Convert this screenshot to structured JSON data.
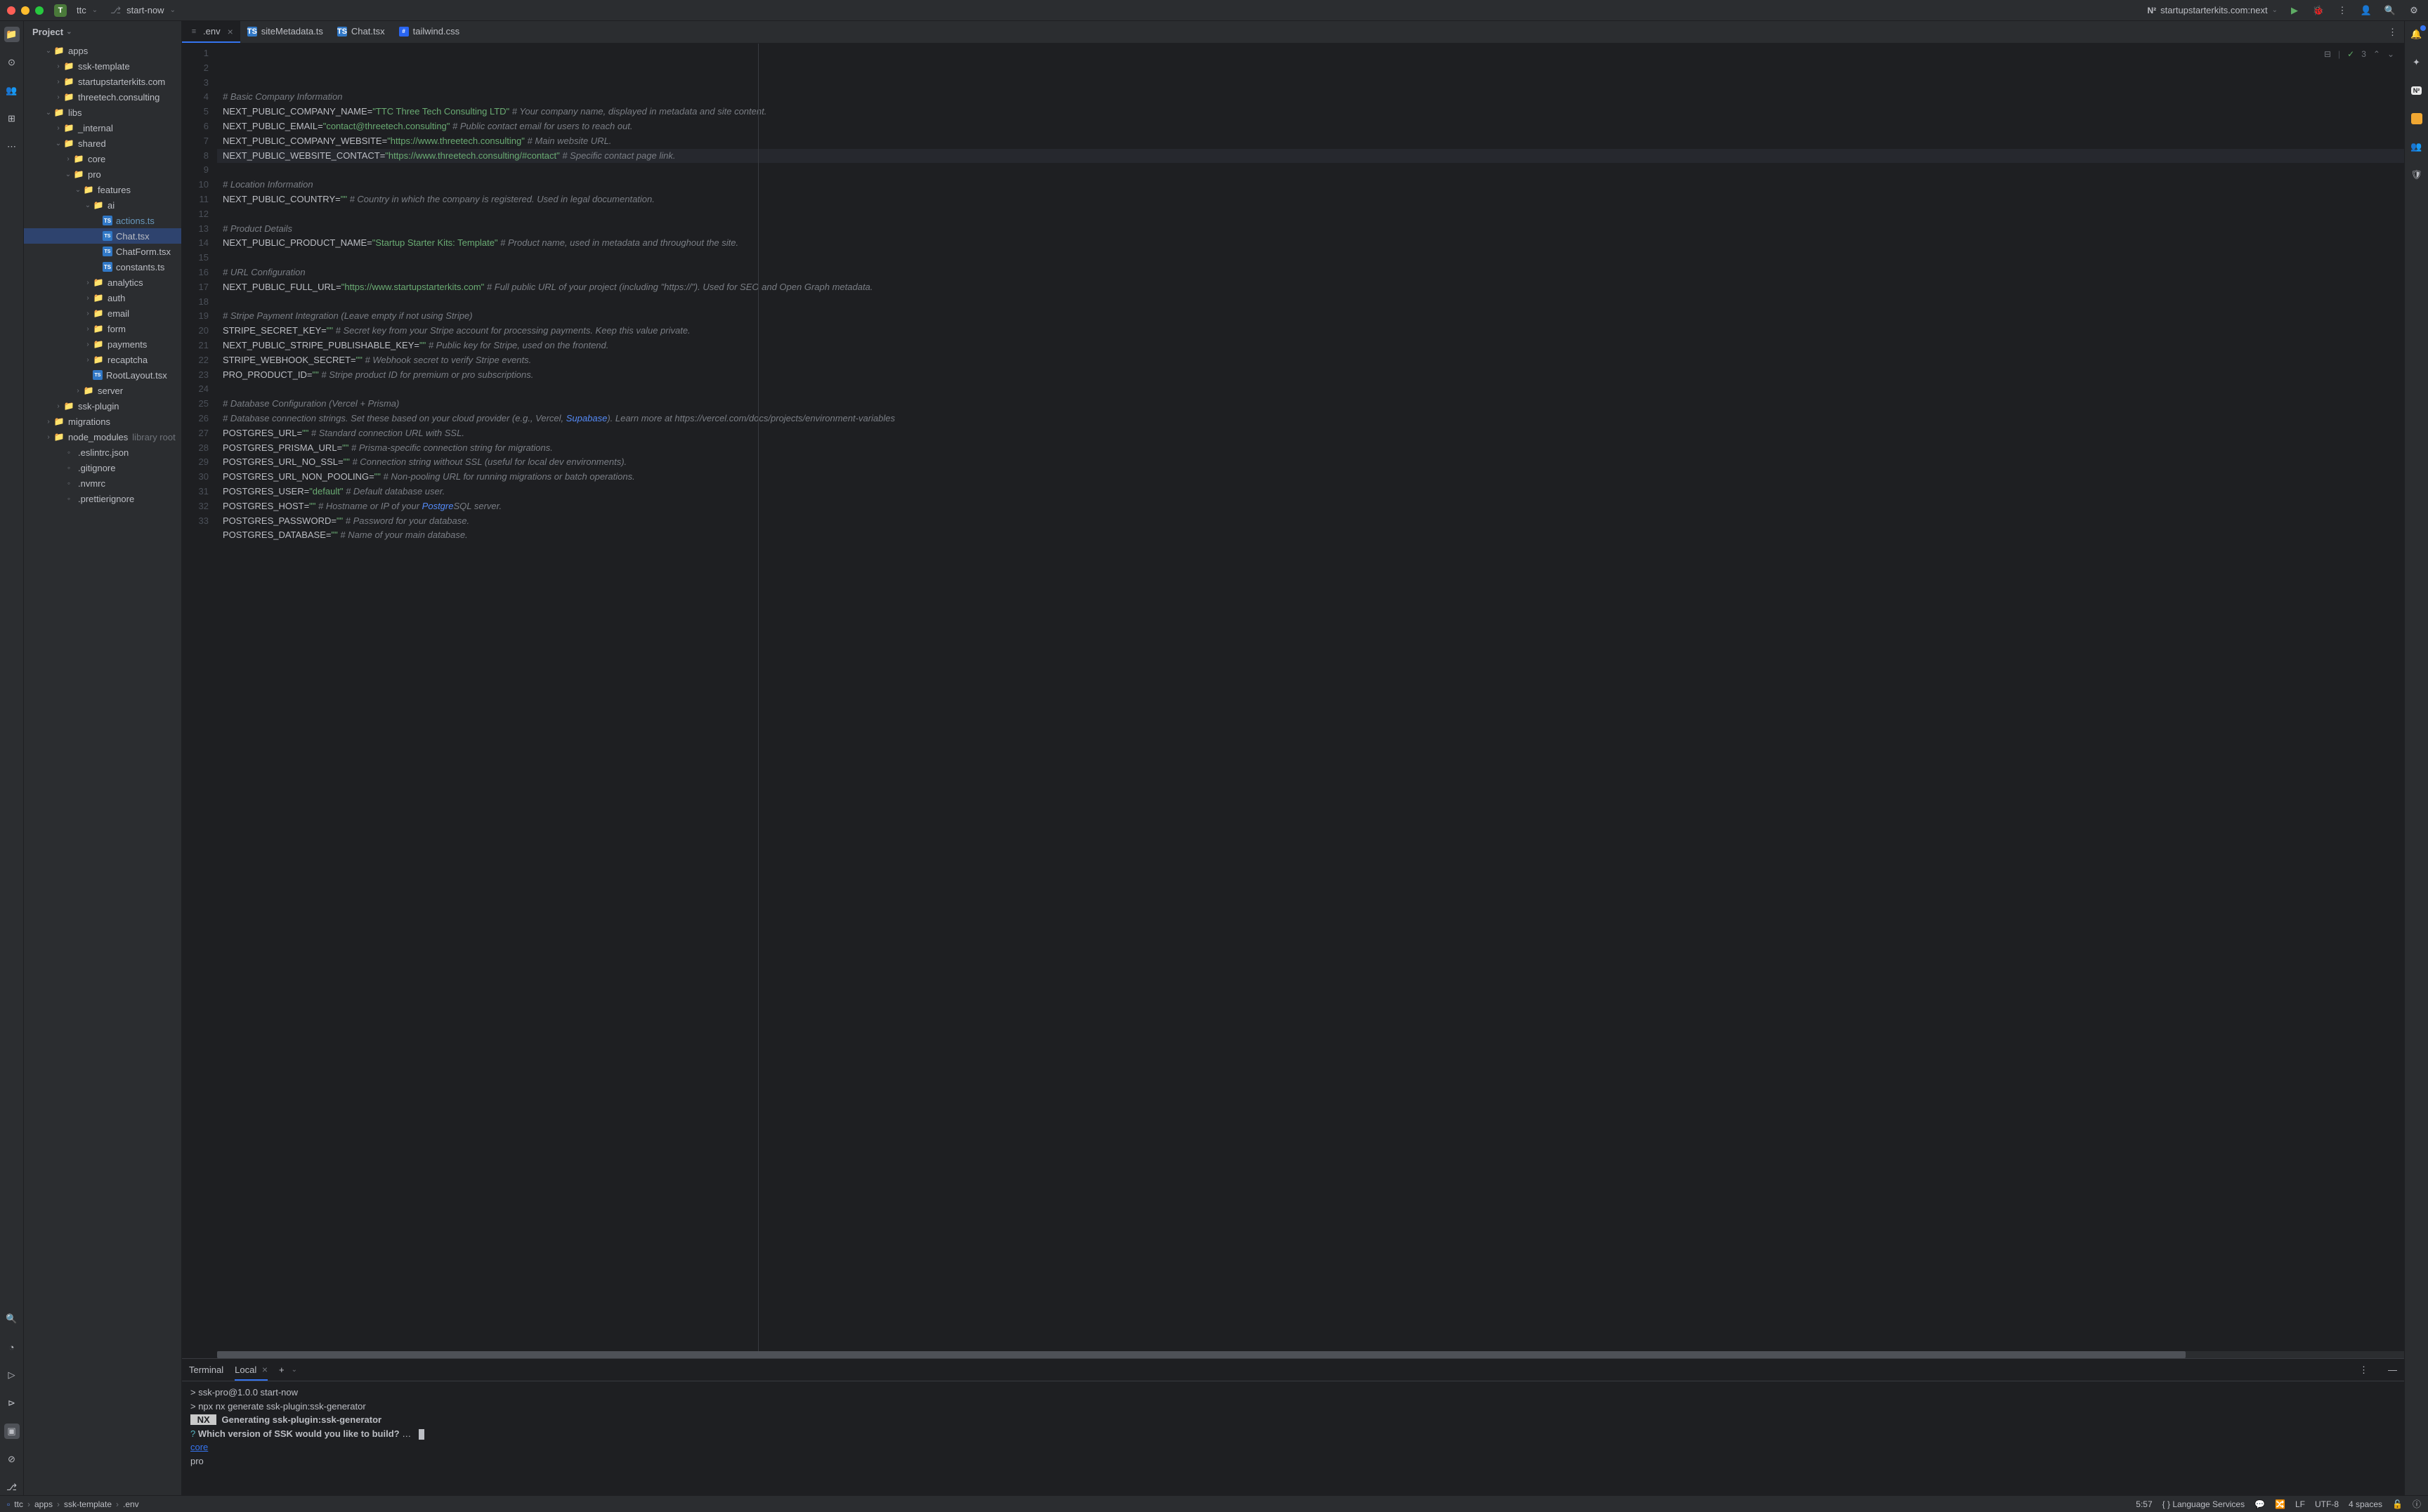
{
  "titlebar": {
    "project_initial": "T",
    "project_name": "ttc",
    "branch": "start-now",
    "run_config_prefix": "N²",
    "run_config": "startupstarterkits.com:next"
  },
  "sidebar": {
    "header": "Project"
  },
  "tree": [
    {
      "depth": 2,
      "chevron": "down",
      "icon": "folder",
      "label": "apps"
    },
    {
      "depth": 3,
      "chevron": "right",
      "icon": "folder",
      "label": "ssk-template"
    },
    {
      "depth": 3,
      "chevron": "right",
      "icon": "folder",
      "label": "startupstarterkits.com"
    },
    {
      "depth": 3,
      "chevron": "right",
      "icon": "folder",
      "label": "threetech.consulting"
    },
    {
      "depth": 2,
      "chevron": "down",
      "icon": "folder",
      "label": "libs"
    },
    {
      "depth": 3,
      "chevron": "right",
      "icon": "folder",
      "label": "_internal"
    },
    {
      "depth": 3,
      "chevron": "down",
      "icon": "folder",
      "label": "shared"
    },
    {
      "depth": 4,
      "chevron": "right",
      "icon": "folder",
      "label": "core"
    },
    {
      "depth": 4,
      "chevron": "down",
      "icon": "folder",
      "label": "pro"
    },
    {
      "depth": 5,
      "chevron": "down",
      "icon": "folder",
      "label": "features"
    },
    {
      "depth": 6,
      "chevron": "down",
      "icon": "folder",
      "label": "ai"
    },
    {
      "depth": 7,
      "chevron": "",
      "icon": "ts",
      "label": "actions.ts",
      "changed": true
    },
    {
      "depth": 7,
      "chevron": "",
      "icon": "tsx",
      "label": "Chat.tsx",
      "selected": true
    },
    {
      "depth": 7,
      "chevron": "",
      "icon": "tsx",
      "label": "ChatForm.tsx"
    },
    {
      "depth": 7,
      "chevron": "",
      "icon": "ts",
      "label": "constants.ts"
    },
    {
      "depth": 6,
      "chevron": "right",
      "icon": "folder",
      "label": "analytics"
    },
    {
      "depth": 6,
      "chevron": "right",
      "icon": "folder",
      "label": "auth"
    },
    {
      "depth": 6,
      "chevron": "right",
      "icon": "folder",
      "label": "email"
    },
    {
      "depth": 6,
      "chevron": "right",
      "icon": "folder",
      "label": "form"
    },
    {
      "depth": 6,
      "chevron": "right",
      "icon": "folder",
      "label": "payments"
    },
    {
      "depth": 6,
      "chevron": "right",
      "icon": "folder",
      "label": "recaptcha"
    },
    {
      "depth": 6,
      "chevron": "",
      "icon": "tsx",
      "label": "RootLayout.tsx"
    },
    {
      "depth": 5,
      "chevron": "right",
      "icon": "folder",
      "label": "server"
    },
    {
      "depth": 3,
      "chevron": "right",
      "icon": "folder",
      "label": "ssk-plugin"
    },
    {
      "depth": 2,
      "chevron": "right",
      "icon": "folder",
      "label": "migrations"
    },
    {
      "depth": 2,
      "chevron": "right",
      "icon": "folder",
      "label": "node_modules",
      "suffix": "library root"
    },
    {
      "depth": 3,
      "chevron": "",
      "icon": "file",
      "label": ".eslintrc.json"
    },
    {
      "depth": 3,
      "chevron": "",
      "icon": "file",
      "label": ".gitignore"
    },
    {
      "depth": 3,
      "chevron": "",
      "icon": "file",
      "label": ".nvmrc"
    },
    {
      "depth": 3,
      "chevron": "",
      "icon": "file",
      "label": ".prettierignore"
    }
  ],
  "tabs": [
    {
      "icon": "env",
      "label": ".env",
      "active": true,
      "closable": true
    },
    {
      "icon": "ts",
      "label": "siteMetadata.ts"
    },
    {
      "icon": "tsx",
      "label": "Chat.tsx"
    },
    {
      "icon": "css",
      "label": "tailwind.css"
    }
  ],
  "editor_indicators": {
    "checks": "3"
  },
  "code_lines": [
    {
      "n": 1,
      "segs": [
        {
          "t": "# Basic Company Information",
          "c": "c-comment"
        }
      ]
    },
    {
      "n": 2,
      "segs": [
        {
          "t": "NEXT_PUBLIC_COMPANY_NAME",
          "c": "c-key"
        },
        {
          "t": "=",
          "c": "c-key"
        },
        {
          "t": "\"TTC Three Tech Consulting LTD\"",
          "c": "c-string"
        },
        {
          "t": " # Your company name, displayed in metadata and site content.",
          "c": "c-comment"
        }
      ]
    },
    {
      "n": 3,
      "segs": [
        {
          "t": "NEXT_PUBLIC_EMAIL",
          "c": "c-key"
        },
        {
          "t": "=",
          "c": "c-key"
        },
        {
          "t": "\"contact@threetech.consulting\"",
          "c": "c-string"
        },
        {
          "t": " # Public contact email for users to reach out.",
          "c": "c-comment"
        }
      ]
    },
    {
      "n": 4,
      "segs": [
        {
          "t": "NEXT_PUBLIC_COMPANY_WEBSITE",
          "c": "c-key"
        },
        {
          "t": "=",
          "c": "c-key"
        },
        {
          "t": "\"https://www.threetech.consulting\"",
          "c": "c-string"
        },
        {
          "t": " # Main website URL.",
          "c": "c-comment"
        }
      ]
    },
    {
      "n": 5,
      "hl": true,
      "segs": [
        {
          "t": "NEXT_PUBLIC_WEBSITE_CONTACT",
          "c": "c-key"
        },
        {
          "t": "=",
          "c": "c-key"
        },
        {
          "t": "\"https://www.threetech.consulting/#contact\"",
          "c": "c-string"
        },
        {
          "t": " # Specific contact page link.",
          "c": "c-comment"
        }
      ]
    },
    {
      "n": 6,
      "segs": []
    },
    {
      "n": 7,
      "segs": [
        {
          "t": "# Location Information",
          "c": "c-comment"
        }
      ]
    },
    {
      "n": 8,
      "segs": [
        {
          "t": "NEXT_PUBLIC_COUNTRY",
          "c": "c-key"
        },
        {
          "t": "=",
          "c": "c-key"
        },
        {
          "t": "\"\"",
          "c": "c-string"
        },
        {
          "t": " # Country in which the company is registered. Used in legal documentation.",
          "c": "c-comment"
        }
      ]
    },
    {
      "n": 9,
      "segs": []
    },
    {
      "n": 10,
      "segs": [
        {
          "t": "# Product Details",
          "c": "c-comment"
        }
      ]
    },
    {
      "n": 11,
      "segs": [
        {
          "t": "NEXT_PUBLIC_PRODUCT_NAME",
          "c": "c-key"
        },
        {
          "t": "=",
          "c": "c-key"
        },
        {
          "t": "\"Startup Starter Kits: Template\"",
          "c": "c-string"
        },
        {
          "t": " # Product name, used in metadata and throughout the site.",
          "c": "c-comment"
        }
      ]
    },
    {
      "n": 12,
      "segs": []
    },
    {
      "n": 13,
      "segs": [
        {
          "t": "# URL Configuration",
          "c": "c-comment"
        }
      ]
    },
    {
      "n": 14,
      "segs": [
        {
          "t": "NEXT_PUBLIC_FULL_URL",
          "c": "c-key"
        },
        {
          "t": "=",
          "c": "c-key"
        },
        {
          "t": "\"https://www.startupstarterkits.com\"",
          "c": "c-string"
        },
        {
          "t": " # Full public URL of your project (including \"https://\"). Used for SEO and Open Graph metadata.",
          "c": "c-comment"
        }
      ]
    },
    {
      "n": 15,
      "segs": []
    },
    {
      "n": 16,
      "segs": [
        {
          "t": "# Stripe Payment Integration (Leave empty if not using Stripe)",
          "c": "c-comment"
        }
      ]
    },
    {
      "n": 17,
      "segs": [
        {
          "t": "STRIPE_SECRET_KEY",
          "c": "c-key"
        },
        {
          "t": "=",
          "c": "c-key"
        },
        {
          "t": "\"\"",
          "c": "c-string"
        },
        {
          "t": " # Secret key from your Stripe account for processing payments. Keep this value private.",
          "c": "c-comment"
        }
      ]
    },
    {
      "n": 18,
      "segs": [
        {
          "t": "NEXT_PUBLIC_STRIPE_PUBLISHABLE_KEY",
          "c": "c-key"
        },
        {
          "t": "=",
          "c": "c-key"
        },
        {
          "t": "\"\"",
          "c": "c-string"
        },
        {
          "t": " # Public key for Stripe, used on the frontend.",
          "c": "c-comment"
        }
      ]
    },
    {
      "n": 19,
      "segs": [
        {
          "t": "STRIPE_WEBHOOK_SECRET",
          "c": "c-key"
        },
        {
          "t": "=",
          "c": "c-key"
        },
        {
          "t": "\"\"",
          "c": "c-string"
        },
        {
          "t": " # Webhook secret to verify Stripe events.",
          "c": "c-comment"
        }
      ]
    },
    {
      "n": 20,
      "segs": [
        {
          "t": "PRO_PRODUCT_ID",
          "c": "c-key"
        },
        {
          "t": "=",
          "c": "c-key"
        },
        {
          "t": "\"\"",
          "c": "c-string"
        },
        {
          "t": " # Stripe product ID for premium or pro subscriptions.",
          "c": "c-comment"
        }
      ]
    },
    {
      "n": 21,
      "segs": []
    },
    {
      "n": 22,
      "segs": [
        {
          "t": "# Database Configuration (Vercel + Prisma)",
          "c": "c-comment"
        }
      ]
    },
    {
      "n": 23,
      "segs": [
        {
          "t": "# Database connection strings. Set these based on your cloud provider (e.g., Vercel, ",
          "c": "c-comment"
        },
        {
          "t": "Supabase",
          "c": "c-link"
        },
        {
          "t": "). Learn more at https://vercel.com/docs/projects/environment-variables",
          "c": "c-comment"
        }
      ]
    },
    {
      "n": 24,
      "segs": [
        {
          "t": "POSTGRES_URL",
          "c": "c-key"
        },
        {
          "t": "=",
          "c": "c-key"
        },
        {
          "t": "\"\"",
          "c": "c-string"
        },
        {
          "t": " # Standard connection URL with SSL.",
          "c": "c-comment"
        }
      ]
    },
    {
      "n": 25,
      "segs": [
        {
          "t": "POSTGRES_PRISMA_URL",
          "c": "c-key"
        },
        {
          "t": "=",
          "c": "c-key"
        },
        {
          "t": "\"\"",
          "c": "c-string"
        },
        {
          "t": " # Prisma-specific connection string for migrations.",
          "c": "c-comment"
        }
      ]
    },
    {
      "n": 26,
      "segs": [
        {
          "t": "POSTGRES_URL_NO_SSL",
          "c": "c-key"
        },
        {
          "t": "=",
          "c": "c-key"
        },
        {
          "t": "\"\"",
          "c": "c-string"
        },
        {
          "t": " # Connection string without SSL (useful for local dev environments).",
          "c": "c-comment"
        }
      ]
    },
    {
      "n": 27,
      "segs": [
        {
          "t": "POSTGRES_URL_NON_POOLING",
          "c": "c-key"
        },
        {
          "t": "=",
          "c": "c-key"
        },
        {
          "t": "\"\"",
          "c": "c-string"
        },
        {
          "t": " # Non-pooling URL for running migrations or batch operations.",
          "c": "c-comment"
        }
      ]
    },
    {
      "n": 28,
      "segs": [
        {
          "t": "POSTGRES_USER",
          "c": "c-key"
        },
        {
          "t": "=",
          "c": "c-key"
        },
        {
          "t": "\"default\"",
          "c": "c-string"
        },
        {
          "t": " # Default database user.",
          "c": "c-comment"
        }
      ]
    },
    {
      "n": 29,
      "segs": [
        {
          "t": "POSTGRES_HOST",
          "c": "c-key"
        },
        {
          "t": "=",
          "c": "c-key"
        },
        {
          "t": "\"\"",
          "c": "c-string"
        },
        {
          "t": " # Hostname or IP of your ",
          "c": "c-comment"
        },
        {
          "t": "Postgre",
          "c": "c-link"
        },
        {
          "t": "SQL server.",
          "c": "c-comment"
        }
      ]
    },
    {
      "n": 30,
      "segs": [
        {
          "t": "POSTGRES_PASSWORD",
          "c": "c-key"
        },
        {
          "t": "=",
          "c": "c-key"
        },
        {
          "t": "\"\"",
          "c": "c-string"
        },
        {
          "t": " # Password for your database.",
          "c": "c-comment"
        }
      ]
    },
    {
      "n": 31,
      "segs": [
        {
          "t": "POSTGRES_DATABASE",
          "c": "c-key"
        },
        {
          "t": "=",
          "c": "c-key"
        },
        {
          "t": "\"\"",
          "c": "c-string"
        },
        {
          "t": " # Name of your main database.",
          "c": "c-comment"
        }
      ]
    },
    {
      "n": 32,
      "segs": []
    },
    {
      "n": 33,
      "segs": []
    }
  ],
  "terminal": {
    "tab_main": "Terminal",
    "tab_local": "Local",
    "lines": [
      {
        "segs": [
          {
            "t": "> ssk-pro@1.0.0 start-now",
            "c": ""
          }
        ]
      },
      {
        "segs": [
          {
            "t": "> npx nx generate ssk-plugin:ssk-generator",
            "c": ""
          }
        ]
      },
      {
        "segs": [
          {
            "t": "",
            "c": ""
          }
        ]
      },
      {
        "segs": [
          {
            "t": "",
            "c": ""
          }
        ]
      },
      {
        "segs": [
          {
            "t": " NX ",
            "c": "term-nx"
          },
          {
            "t": "  Generating ssk-plugin:ssk-generator",
            "c": "term-bold"
          }
        ]
      },
      {
        "segs": [
          {
            "t": "",
            "c": ""
          }
        ]
      },
      {
        "segs": [
          {
            "t": "?",
            "c": "term-cyan"
          },
          {
            "t": " Which version of SSK would you like to build? ",
            "c": "term-bold"
          },
          {
            "t": "… ",
            "c": ""
          }
        ]
      },
      {
        "segs": [
          {
            "t": "core",
            "c": "term-blue"
          }
        ]
      },
      {
        "segs": [
          {
            "t": "pro",
            "c": ""
          }
        ]
      }
    ]
  },
  "statusbar": {
    "crumbs": [
      "ttc",
      "apps",
      "ssk-template",
      ".env"
    ],
    "position": "5:57",
    "lang": "Language Services",
    "line_ending": "LF",
    "encoding": "UTF-8",
    "indent": "4 spaces"
  }
}
